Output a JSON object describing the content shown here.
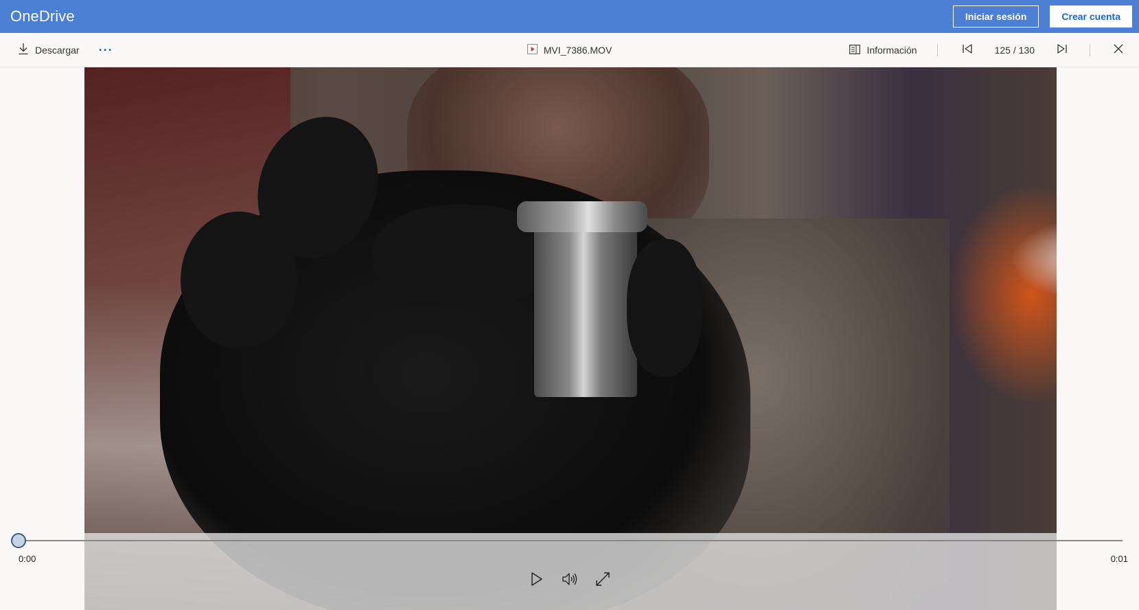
{
  "header": {
    "brand": "OneDrive",
    "signin_label": "Iniciar sesión",
    "create_account_label": "Crear cuenta",
    "brand_color": "#4a7fd3"
  },
  "toolbar": {
    "download_label": "Descargar",
    "more_label": "···",
    "file_name": "MVI_7386.MOV",
    "info_label": "Información",
    "counter": "125 / 130"
  },
  "player": {
    "current_time": "0:00",
    "duration": "0:01",
    "progress": 0.0
  },
  "icons": {
    "download": "download-icon",
    "more": "more-icon",
    "file": "video-file-icon",
    "info": "info-panel-icon",
    "previous": "previous-icon",
    "next": "next-icon",
    "close": "close-icon",
    "play": "play-icon",
    "volume": "volume-icon",
    "fullscreen": "fullscreen-icon"
  }
}
